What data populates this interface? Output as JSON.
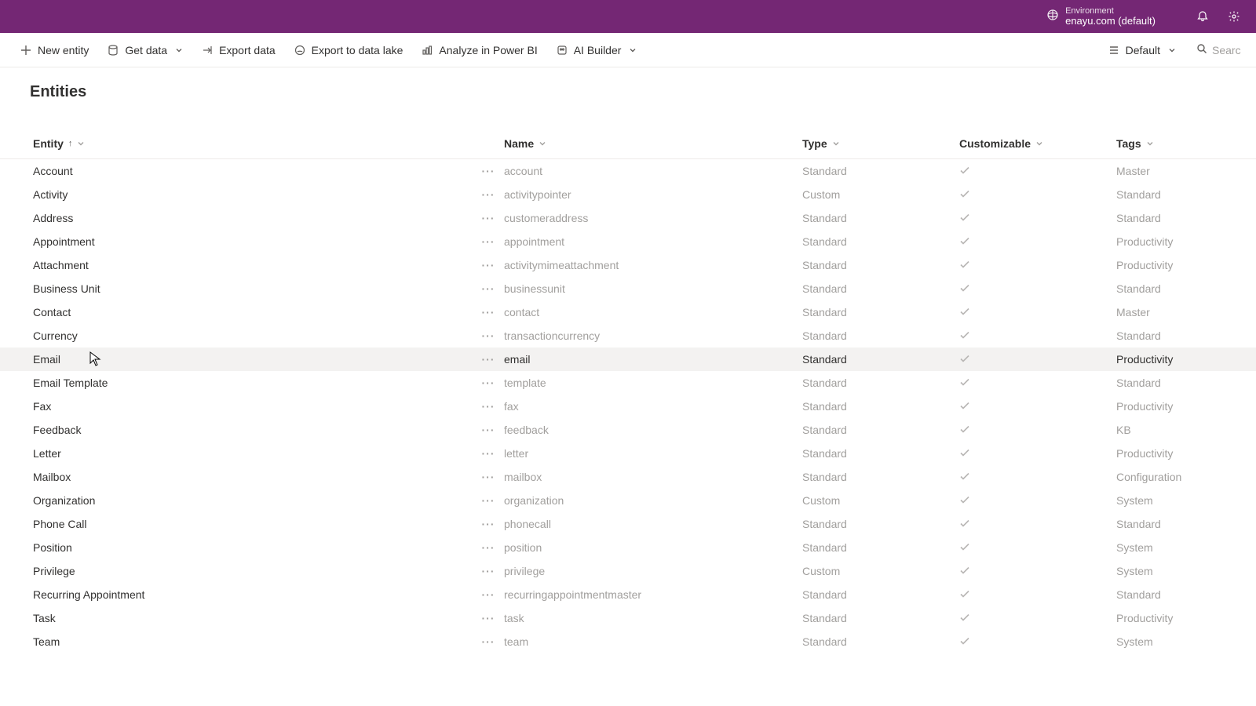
{
  "header": {
    "environment_label": "Environment",
    "environment_value": "enayu.com (default)"
  },
  "commandbar": {
    "new_entity": "New entity",
    "get_data": "Get data",
    "export_data": "Export data",
    "export_lake": "Export to data lake",
    "analyze_bi": "Analyze in Power BI",
    "ai_builder": "AI Builder",
    "view_default": "Default",
    "search_placeholder": "Searc"
  },
  "page": {
    "title": "Entities"
  },
  "columns": {
    "entity": "Entity",
    "name": "Name",
    "type": "Type",
    "customizable": "Customizable",
    "tags": "Tags"
  },
  "rows": [
    {
      "entity": "Account",
      "name": "account",
      "type": "Standard",
      "customizable": true,
      "tags": "Master",
      "highlight": false
    },
    {
      "entity": "Activity",
      "name": "activitypointer",
      "type": "Custom",
      "customizable": true,
      "tags": "Standard",
      "highlight": false
    },
    {
      "entity": "Address",
      "name": "customeraddress",
      "type": "Standard",
      "customizable": true,
      "tags": "Standard",
      "highlight": false
    },
    {
      "entity": "Appointment",
      "name": "appointment",
      "type": "Standard",
      "customizable": true,
      "tags": "Productivity",
      "highlight": false
    },
    {
      "entity": "Attachment",
      "name": "activitymimeattachment",
      "type": "Standard",
      "customizable": true,
      "tags": "Productivity",
      "highlight": false
    },
    {
      "entity": "Business Unit",
      "name": "businessunit",
      "type": "Standard",
      "customizable": true,
      "tags": "Standard",
      "highlight": false
    },
    {
      "entity": "Contact",
      "name": "contact",
      "type": "Standard",
      "customizable": true,
      "tags": "Master",
      "highlight": false
    },
    {
      "entity": "Currency",
      "name": "transactioncurrency",
      "type": "Standard",
      "customizable": true,
      "tags": "Standard",
      "highlight": false
    },
    {
      "entity": "Email",
      "name": "email",
      "type": "Standard",
      "customizable": true,
      "tags": "Productivity",
      "highlight": true
    },
    {
      "entity": "Email Template",
      "name": "template",
      "type": "Standard",
      "customizable": true,
      "tags": "Standard",
      "highlight": false
    },
    {
      "entity": "Fax",
      "name": "fax",
      "type": "Standard",
      "customizable": true,
      "tags": "Productivity",
      "highlight": false
    },
    {
      "entity": "Feedback",
      "name": "feedback",
      "type": "Standard",
      "customizable": true,
      "tags": "KB",
      "highlight": false
    },
    {
      "entity": "Letter",
      "name": "letter",
      "type": "Standard",
      "customizable": true,
      "tags": "Productivity",
      "highlight": false
    },
    {
      "entity": "Mailbox",
      "name": "mailbox",
      "type": "Standard",
      "customizable": true,
      "tags": "Configuration",
      "highlight": false
    },
    {
      "entity": "Organization",
      "name": "organization",
      "type": "Custom",
      "customizable": true,
      "tags": "System",
      "highlight": false
    },
    {
      "entity": "Phone Call",
      "name": "phonecall",
      "type": "Standard",
      "customizable": true,
      "tags": "Standard",
      "highlight": false
    },
    {
      "entity": "Position",
      "name": "position",
      "type": "Standard",
      "customizable": true,
      "tags": "System",
      "highlight": false
    },
    {
      "entity": "Privilege",
      "name": "privilege",
      "type": "Custom",
      "customizable": true,
      "tags": "System",
      "highlight": false
    },
    {
      "entity": "Recurring Appointment",
      "name": "recurringappointmentmaster",
      "type": "Standard",
      "customizable": true,
      "tags": "Standard",
      "highlight": false
    },
    {
      "entity": "Task",
      "name": "task",
      "type": "Standard",
      "customizable": true,
      "tags": "Productivity",
      "highlight": false
    },
    {
      "entity": "Team",
      "name": "team",
      "type": "Standard",
      "customizable": true,
      "tags": "System",
      "highlight": false
    }
  ]
}
